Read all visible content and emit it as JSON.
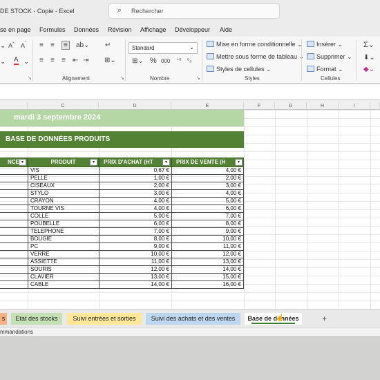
{
  "window": {
    "title": "DE STOCK - Copie  -  Excel"
  },
  "search": {
    "placeholder": "Rechercher"
  },
  "menu": [
    "se en page",
    "Formules",
    "Données",
    "Révision",
    "Affichage",
    "Développeur",
    "Aide"
  ],
  "ribbon": {
    "number_format": "Standard",
    "styles": {
      "conditional": "Mise en forme conditionnelle",
      "as_table": "Mettre sous forme de tableau",
      "cell_styles": "Styles de cellules"
    },
    "cells": {
      "insert": "Insérer",
      "delete": "Supprimer",
      "format": "Format"
    },
    "groups": {
      "alignment": "Alignement",
      "number": "Nombre",
      "styles": "Styles",
      "cells": "Cellules"
    },
    "number_symbols": {
      "percent": "%",
      "thousands": "000"
    }
  },
  "columns": [
    "C",
    "D",
    "E",
    "F",
    "G",
    "H",
    "I"
  ],
  "sheet": {
    "date": "mardi 3 septembre 2024",
    "title": "BASE DE DONNÉES PRODUITS",
    "headers": {
      "ref": "NCE",
      "product": "PRODUIT",
      "buy": "PRIX D'ACHAT (HT",
      "sell": "PRIX DE VENTE (H"
    },
    "rows": [
      {
        "product": "VIS",
        "buy": "0,67 €",
        "sell": "4,00 €"
      },
      {
        "product": "PELLE",
        "buy": "1,00 €",
        "sell": "2,00 €"
      },
      {
        "product": "CISEAUX",
        "buy": "2,00 €",
        "sell": "3,00 €"
      },
      {
        "product": "STYLO",
        "buy": "3,00 €",
        "sell": "4,00 €"
      },
      {
        "product": "CRAYON",
        "buy": "4,00 €",
        "sell": "5,00 €"
      },
      {
        "product": "TOURNE VIS",
        "buy": "4,00 €",
        "sell": "6,00 €"
      },
      {
        "product": "COLLE",
        "buy": "5,00 €",
        "sell": "7,00 €"
      },
      {
        "product": "POUBELLE",
        "buy": "6,00 €",
        "sell": "8,00 €"
      },
      {
        "product": "TELEPHONE",
        "buy": "7,00 €",
        "sell": "9,00 €"
      },
      {
        "product": "BOUGIE",
        "buy": "8,00 €",
        "sell": "10,00 €"
      },
      {
        "product": "PC",
        "buy": "9,00 €",
        "sell": "11,00 €"
      },
      {
        "product": "VERRE",
        "buy": "10,00 €",
        "sell": "12,00 €"
      },
      {
        "product": "ASSIETTE",
        "buy": "11,00 €",
        "sell": "13,00 €"
      },
      {
        "product": "SOURIS",
        "buy": "12,00 €",
        "sell": "14,00 €"
      },
      {
        "product": "CLAVIER",
        "buy": "13,00 €",
        "sell": "15,00 €"
      },
      {
        "product": "CABLE",
        "buy": "14,00 €",
        "sell": "16,00 €"
      }
    ]
  },
  "tabs": [
    {
      "label": "s",
      "color": "#f4b183"
    },
    {
      "label": "Etat des stocks",
      "color": "#c5e0b4"
    },
    {
      "label": "Suivi entrées et sorties",
      "color": "#ffe699"
    },
    {
      "label": "Suivi des achats et des ventes",
      "color": "#bdd7ee"
    },
    {
      "label": "Base de données",
      "color": "#ffffff",
      "active": true
    }
  ],
  "add_sheet": "+",
  "status": "mmandations",
  "colors": {
    "header_green": "#548235",
    "date_banner": "#b5d6a5",
    "accent": "#3a7d34"
  }
}
